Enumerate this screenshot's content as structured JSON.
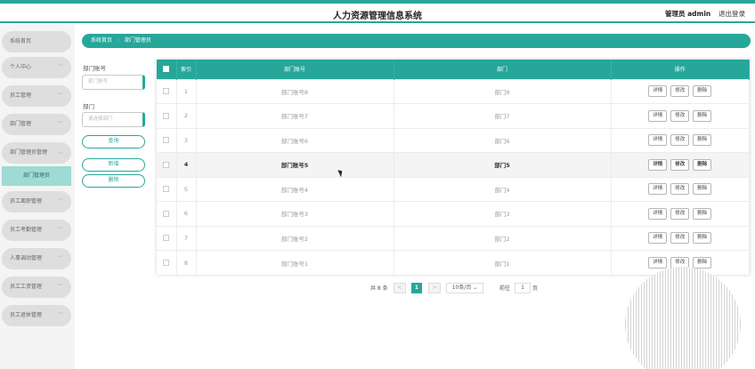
{
  "header": {
    "title": "人力资源管理信息系统",
    "admin": "管理员 admin",
    "logout": "退出登录"
  },
  "sidebar": {
    "items": [
      {
        "label": "系统首页"
      },
      {
        "label": "个人中心"
      },
      {
        "label": "员工管理"
      },
      {
        "label": "部门管理"
      },
      {
        "label": "部门管理员管理"
      },
      {
        "label": "员工离职管理"
      },
      {
        "label": "员工考勤管理"
      },
      {
        "label": "人事调动管理"
      },
      {
        "label": "员工工资管理"
      },
      {
        "label": "员工退休管理"
      }
    ],
    "active_sub": "部门管理员"
  },
  "breadcrumb": {
    "home": "系统首页",
    "sep": ":",
    "current": "部门管理员"
  },
  "filters": {
    "dept_no_label": "部门账号",
    "dept_no_placeholder": "部门账号",
    "dept_label": "部门",
    "dept_placeholder": "请选择部门",
    "query": "查询",
    "add": "新增",
    "delete": "删除"
  },
  "table": {
    "headers": {
      "index": "索引",
      "account": "部门账号",
      "dept": "部门",
      "ops": "操作"
    },
    "actions": {
      "detail": "详情",
      "edit": "修改",
      "delete": "删除"
    },
    "rows": [
      {
        "index": "1",
        "account": "部门账号8",
        "dept": "部门8"
      },
      {
        "index": "2",
        "account": "部门账号7",
        "dept": "部门7"
      },
      {
        "index": "3",
        "account": "部门账号6",
        "dept": "部门6"
      },
      {
        "index": "4",
        "account": "部门账号5",
        "dept": "部门5"
      },
      {
        "index": "5",
        "account": "部门账号4",
        "dept": "部门4"
      },
      {
        "index": "6",
        "account": "部门账号3",
        "dept": "部门3"
      },
      {
        "index": "7",
        "account": "部门账号2",
        "dept": "部门2"
      },
      {
        "index": "8",
        "account": "部门账号1",
        "dept": "部门1"
      }
    ],
    "highlighted_row": 4
  },
  "pager": {
    "total": "共 8 条",
    "prev": "<",
    "page": "1",
    "next": ">",
    "size": "10条/页",
    "goto": "前往",
    "goto_value": "1",
    "page_unit": "页"
  }
}
